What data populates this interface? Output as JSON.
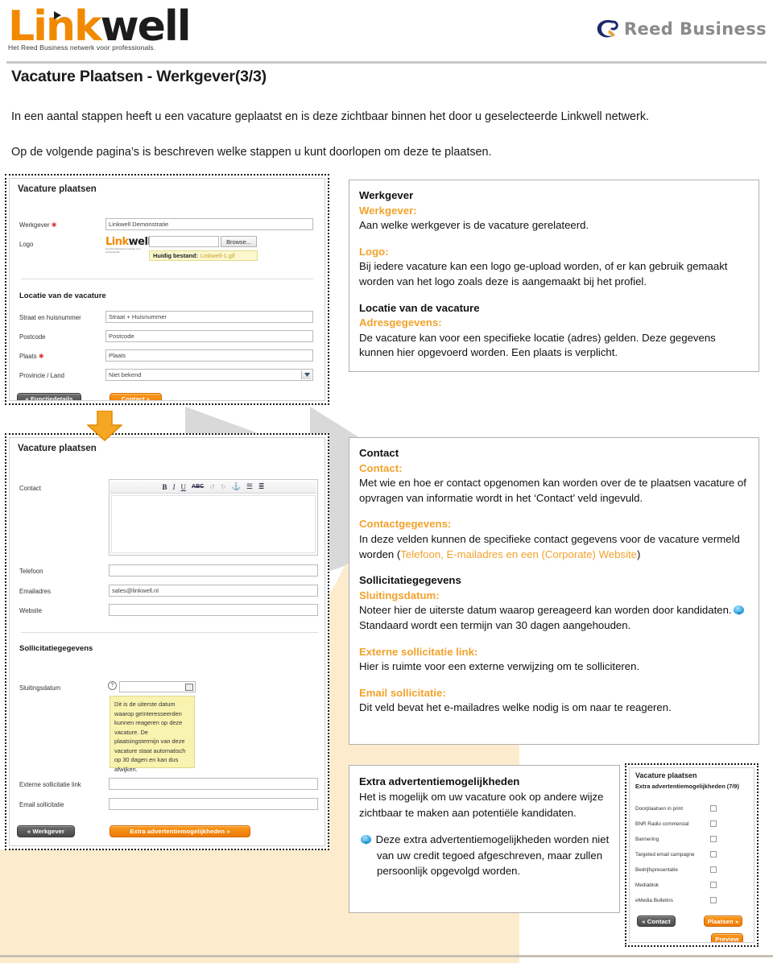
{
  "header": {
    "brand_logo": {
      "part1": "L",
      "part2": "ink",
      "part3": "well",
      "tagline": "Het Reed Business netwerk voor professionals."
    },
    "partner_logo": {
      "text": "Reed Business"
    }
  },
  "page_title": "Vacature Plaatsen - Werkgever(3/3)",
  "intro": {
    "line1": "In een aantal stappen heeft u een vacature geplaatst en is deze zichtbaar binnen het door u geselecteerde Linkwell netwerk.",
    "line2": "Op de volgende pagina’s is beschreven welke stappen u kunt doorlopen om deze te plaatsen."
  },
  "screenshot1": {
    "title": "Vacature plaatsen",
    "fields": {
      "werkgever_label": "Werkgever",
      "werkgever_value": "Linkwell Demonstratie",
      "logo_label": "Logo",
      "logo_brand": "Linkwell",
      "browse_button": "Browse...",
      "huidig_bestand_label": "Huidig bestand:",
      "huidig_bestand_file": "Linkwell-1.gif",
      "section_locatie": "Locatie van de vacature",
      "straat_label": "Straat en huisnummer",
      "straat_value": "Straat + Huisnummer",
      "postcode_label": "Postcode",
      "postcode_value": "Postcode",
      "plaats_label": "Plaats",
      "plaats_value": "Plaats",
      "provincie_label": "Provincie / Land",
      "provincie_value": "Niet bekend"
    },
    "buttons": {
      "back": "« Functiedetails",
      "next": "Contact »"
    }
  },
  "screenshot2": {
    "title": "Vacature plaatsen",
    "fields": {
      "contact_label": "Contact",
      "telefoon_label": "Telefoon",
      "telefoon_value": "",
      "emailadres_label": "Emailadres",
      "emailadres_value": "sales@linkwell.nl",
      "website_label": "Website",
      "website_value": "",
      "section_sollicitatie": "Sollicitatiegegevens",
      "sluitingsdatum_label": "Sluitingsdatum",
      "externe_link_label": "Externe sollicitatie link",
      "email_sollicitatie_label": "Email sollicitatie"
    },
    "tooltip": "Dit is de uiterste datum waarop geïnteresseerden kunnen reageren op deze vacature. De plaatsingstermijn van deze vacature staat automatisch op 30 dagen en kan dus afwijken.",
    "editor_toolbar": [
      "B",
      "I",
      "U",
      "ABC",
      "undo",
      "redo",
      "anchor",
      "bullet-list",
      "numbered-list"
    ],
    "buttons": {
      "back": "« Werkgever",
      "next": "Extra advertentiemogelijkheden »"
    }
  },
  "screenshot3": {
    "title": "Vacature plaatsen",
    "subtitle": "Extra advertentiemogelijkheden (7/9)",
    "options": [
      "Doorplaatsen in print",
      "BNR Radio commercial",
      "Bannering",
      "Targeted email campagne",
      "Bedrijfspresentatie",
      "Mediablok",
      "eMedia Bulletins"
    ],
    "buttons": {
      "back": "« Contact",
      "place": "Plaatsen »",
      "preview": "Preview"
    }
  },
  "callout1": {
    "h1": "Werkgever",
    "sub1": "Werkgever:",
    "body1": "Aan welke werkgever is de vacature gerelateerd.",
    "sub2": "Logo:",
    "body2": "Bij iedere vacature kan een logo ge-upload worden, of er kan gebruik gemaakt worden van het logo zoals deze is aangemaakt bij het profiel.",
    "h2": "Locatie van de vacature",
    "sub3": "Adresgegevens:",
    "body3": "De vacature kan voor een specifieke locatie (adres) gelden. Deze gegevens kunnen hier opgevoerd worden. Een plaats is verplicht."
  },
  "callout2": {
    "h1": "Contact",
    "sub1": "Contact:",
    "body1": "Met wie en hoe er contact opgenomen kan worden over de te plaatsen vacature of opvragen van informatie wordt in het ‘Contact’ veld ingevuld.",
    "sub2": "Contactgegevens:",
    "body2_pre": "In deze velden kunnen de specifieke contact gegevens voor de vacature vermeld worden (",
    "body2_orange": "Telefoon, E-mailadres en een (Corporate) Website",
    "body2_post": ")",
    "h2": "Sollicitatiegegevens",
    "sub3": "Sluitingsdatum:",
    "body3_pre": "Noteer hier de uiterste datum waarop gereageerd kan worden door kandidaten.",
    "body3_post": "Standaard wordt een termijn van 30 dagen aangehouden.",
    "sub4": "Externe sollicitatie link:",
    "body4": "Hier is ruimte voor een externe verwijzing om te solliciteren.",
    "sub5": "Email sollicitatie:",
    "body5": "Dit veld bevat het e-mailadres welke nodig is om naar te reageren."
  },
  "callout3": {
    "h1": "Extra advertentiemogelijkheden",
    "body1": "Het is mogelijk om uw vacature ook op andere wijze zichtbaar te maken aan potentiële kandidaten.",
    "body2": "Deze extra advertentiemogelijkheden worden niet van uw credit tegoed afgeschreven, maar zullen persoonlijk opgevolgd worden."
  },
  "colors": {
    "orange": "#F2A22B",
    "brand_orange": "#F18A00",
    "grey_wedge": "#D9D9D9",
    "cream": "#FCEBCD"
  }
}
